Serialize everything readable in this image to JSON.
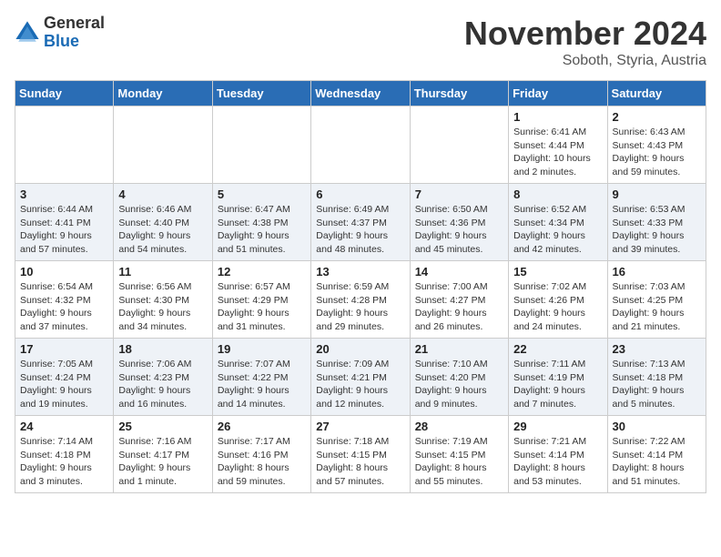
{
  "logo": {
    "general": "General",
    "blue": "Blue"
  },
  "header": {
    "month": "November 2024",
    "location": "Soboth, Styria, Austria"
  },
  "weekdays": [
    "Sunday",
    "Monday",
    "Tuesday",
    "Wednesday",
    "Thursday",
    "Friday",
    "Saturday"
  ],
  "weeks": [
    [
      {
        "day": "",
        "info": ""
      },
      {
        "day": "",
        "info": ""
      },
      {
        "day": "",
        "info": ""
      },
      {
        "day": "",
        "info": ""
      },
      {
        "day": "",
        "info": ""
      },
      {
        "day": "1",
        "info": "Sunrise: 6:41 AM\nSunset: 4:44 PM\nDaylight: 10 hours and 2 minutes."
      },
      {
        "day": "2",
        "info": "Sunrise: 6:43 AM\nSunset: 4:43 PM\nDaylight: 9 hours and 59 minutes."
      }
    ],
    [
      {
        "day": "3",
        "info": "Sunrise: 6:44 AM\nSunset: 4:41 PM\nDaylight: 9 hours and 57 minutes."
      },
      {
        "day": "4",
        "info": "Sunrise: 6:46 AM\nSunset: 4:40 PM\nDaylight: 9 hours and 54 minutes."
      },
      {
        "day": "5",
        "info": "Sunrise: 6:47 AM\nSunset: 4:38 PM\nDaylight: 9 hours and 51 minutes."
      },
      {
        "day": "6",
        "info": "Sunrise: 6:49 AM\nSunset: 4:37 PM\nDaylight: 9 hours and 48 minutes."
      },
      {
        "day": "7",
        "info": "Sunrise: 6:50 AM\nSunset: 4:36 PM\nDaylight: 9 hours and 45 minutes."
      },
      {
        "day": "8",
        "info": "Sunrise: 6:52 AM\nSunset: 4:34 PM\nDaylight: 9 hours and 42 minutes."
      },
      {
        "day": "9",
        "info": "Sunrise: 6:53 AM\nSunset: 4:33 PM\nDaylight: 9 hours and 39 minutes."
      }
    ],
    [
      {
        "day": "10",
        "info": "Sunrise: 6:54 AM\nSunset: 4:32 PM\nDaylight: 9 hours and 37 minutes."
      },
      {
        "day": "11",
        "info": "Sunrise: 6:56 AM\nSunset: 4:30 PM\nDaylight: 9 hours and 34 minutes."
      },
      {
        "day": "12",
        "info": "Sunrise: 6:57 AM\nSunset: 4:29 PM\nDaylight: 9 hours and 31 minutes."
      },
      {
        "day": "13",
        "info": "Sunrise: 6:59 AM\nSunset: 4:28 PM\nDaylight: 9 hours and 29 minutes."
      },
      {
        "day": "14",
        "info": "Sunrise: 7:00 AM\nSunset: 4:27 PM\nDaylight: 9 hours and 26 minutes."
      },
      {
        "day": "15",
        "info": "Sunrise: 7:02 AM\nSunset: 4:26 PM\nDaylight: 9 hours and 24 minutes."
      },
      {
        "day": "16",
        "info": "Sunrise: 7:03 AM\nSunset: 4:25 PM\nDaylight: 9 hours and 21 minutes."
      }
    ],
    [
      {
        "day": "17",
        "info": "Sunrise: 7:05 AM\nSunset: 4:24 PM\nDaylight: 9 hours and 19 minutes."
      },
      {
        "day": "18",
        "info": "Sunrise: 7:06 AM\nSunset: 4:23 PM\nDaylight: 9 hours and 16 minutes."
      },
      {
        "day": "19",
        "info": "Sunrise: 7:07 AM\nSunset: 4:22 PM\nDaylight: 9 hours and 14 minutes."
      },
      {
        "day": "20",
        "info": "Sunrise: 7:09 AM\nSunset: 4:21 PM\nDaylight: 9 hours and 12 minutes."
      },
      {
        "day": "21",
        "info": "Sunrise: 7:10 AM\nSunset: 4:20 PM\nDaylight: 9 hours and 9 minutes."
      },
      {
        "day": "22",
        "info": "Sunrise: 7:11 AM\nSunset: 4:19 PM\nDaylight: 9 hours and 7 minutes."
      },
      {
        "day": "23",
        "info": "Sunrise: 7:13 AM\nSunset: 4:18 PM\nDaylight: 9 hours and 5 minutes."
      }
    ],
    [
      {
        "day": "24",
        "info": "Sunrise: 7:14 AM\nSunset: 4:18 PM\nDaylight: 9 hours and 3 minutes."
      },
      {
        "day": "25",
        "info": "Sunrise: 7:16 AM\nSunset: 4:17 PM\nDaylight: 9 hours and 1 minute."
      },
      {
        "day": "26",
        "info": "Sunrise: 7:17 AM\nSunset: 4:16 PM\nDaylight: 8 hours and 59 minutes."
      },
      {
        "day": "27",
        "info": "Sunrise: 7:18 AM\nSunset: 4:15 PM\nDaylight: 8 hours and 57 minutes."
      },
      {
        "day": "28",
        "info": "Sunrise: 7:19 AM\nSunset: 4:15 PM\nDaylight: 8 hours and 55 minutes."
      },
      {
        "day": "29",
        "info": "Sunrise: 7:21 AM\nSunset: 4:14 PM\nDaylight: 8 hours and 53 minutes."
      },
      {
        "day": "30",
        "info": "Sunrise: 7:22 AM\nSunset: 4:14 PM\nDaylight: 8 hours and 51 minutes."
      }
    ]
  ]
}
